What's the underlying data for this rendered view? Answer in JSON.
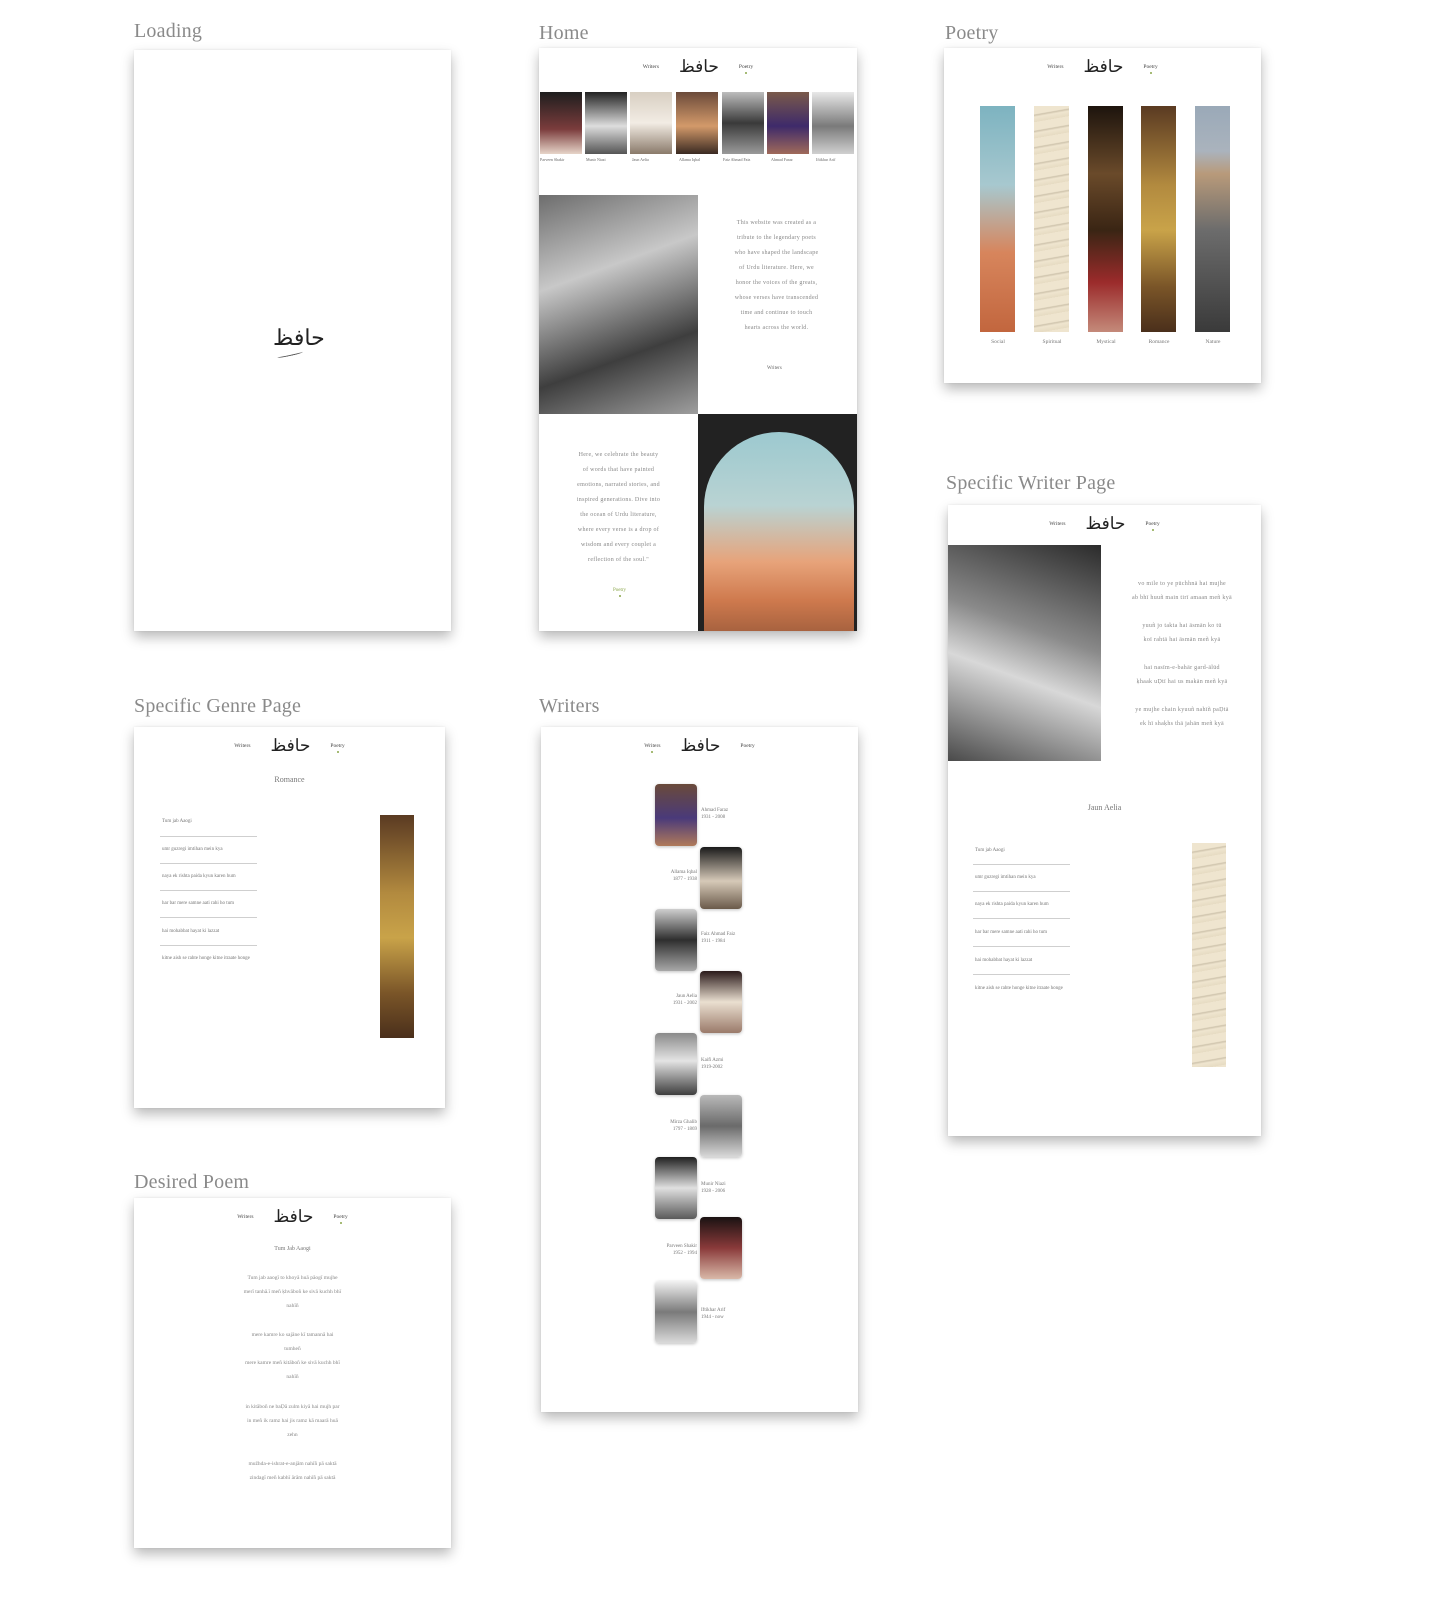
{
  "captions": {
    "loading": "Loading",
    "home": "Home",
    "poetry": "Poetry",
    "genre": "Specific Genre Page",
    "writers": "Writers",
    "writer_page": "Specific Writer Page",
    "poem": "Desired Poem"
  },
  "nav": {
    "writers": "Writers",
    "poetry": "Poetry",
    "logo": "حافظ"
  },
  "home": {
    "carousel": [
      "Parveen Shakir",
      "Munir Niazi",
      "Jaun Aelia",
      "Allama Iqbal",
      "Faiz Ahmad Faiz",
      "Ahmad Faraz",
      "Iftikhar Arif"
    ],
    "intro_lines": [
      "This website was created as a",
      "tribute to the legendary poets",
      "who have shaped the landscape",
      "of Urdu literature. Here, we",
      "honor the voices of the greats,",
      "whose verses have transcended",
      "time and continue to touch",
      "hearts across the world."
    ],
    "intro_link": "Writers",
    "celebrate_lines": [
      "Here, we celebrate the beauty",
      "of words that have painted",
      "emotions, narrated stories, and",
      "inspired generations. Dive into",
      "the ocean of Urdu literature,",
      "where every verse is a drop of",
      "wisdom and every couplet a",
      "reflection of the soul.\""
    ],
    "celebrate_link": "Poetry"
  },
  "poetry": {
    "genres": [
      "Social",
      "Spiritual",
      "Mystical",
      "Romance",
      "Nature"
    ]
  },
  "genre_page": {
    "title": "Romance",
    "items": [
      "Tum jab Aaogi",
      "umr guzregi imtihan mein kya",
      "naya ek rishta paida kyun karen hum",
      "har bar mere samne aati rahi ho tum",
      "hai mohabbat hayat ki lazzat",
      "kitne aish se rahte honge kitne itraate honge"
    ]
  },
  "writers_page": {
    "writers": [
      {
        "name": "Ahmad Faraz",
        "years": "1931 - 2008"
      },
      {
        "name": "Allama Iqbal",
        "years": "1877 - 1938"
      },
      {
        "name": "Faiz Ahmad Faiz",
        "years": "1911 - 1984"
      },
      {
        "name": "Jaun Aelia",
        "years": "1931 - 2002"
      },
      {
        "name": "Kaifi Azmi",
        "years": "1919-2002"
      },
      {
        "name": "Mirza Ghalib",
        "years": "1797 - 1869"
      },
      {
        "name": "Munir Niazi",
        "years": "1928 - 2006"
      },
      {
        "name": "Parveen Shakir",
        "years": "1952 - 1994"
      },
      {
        "name": "Iftikhar Arif",
        "years": "1944 - now"
      }
    ]
  },
  "writer_page": {
    "couplets": [
      [
        "vo mile to ye pūchhnā hai mujhe",
        "ab bhī huuñ main tirī amaan meñ kyā"
      ],
      [
        "yuuñ jo takta hai āsmān ko tū",
        "koī rahtā hai āsmān meñ kyā"
      ],
      [
        "hai nasīm-e-bahār gard-ālūd",
        "ḳhaak uḌtī hai us makān meñ kyā"
      ],
      [
        "ye mujhe chain kyuuñ nahīñ paḌtā",
        "ek hī shaḳhs thā jahān meñ kyā"
      ]
    ],
    "name": "Jaun Aelia",
    "items": [
      "Tum jab Aaogi",
      "umr guzregi imtihan mein kya",
      "naya ek rishta paida kyun karen hum",
      "har bar mere samne aati rahi ho tum",
      "hai mohabbat hayat ki lazzat",
      "kitne aish se rahte honge kitne itraate honge"
    ]
  },
  "poem_page": {
    "title": "Tum Jab Aaogi",
    "lines": [
      "Tum jab aaogī to khoyā huā pāogī mujhe",
      "merī tanhā.ī meñ ḳhvāboñ ke sivā kuchh bhī",
      "nahīñ",
      "mere kamre ko sajāne kī tamannā hai",
      "tumheñ",
      "mere kamre meñ kitāboñ ke sivā kuchh bhī",
      "nahīñ",
      "in kitāboñ ne baḌā zulm kiyā hai mujh par",
      "in meñ ik ramz hai jis ramz kā maarā huā",
      "zehn",
      "mužhda-e-ishrat-e-anjām nahīñ pā saktā",
      "zindagī meñ kabhī ārām nahīñ pā saktā"
    ]
  }
}
